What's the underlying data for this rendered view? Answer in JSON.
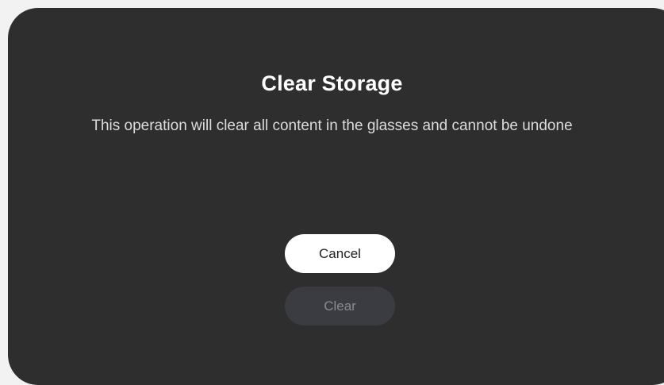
{
  "dialog": {
    "title": "Clear Storage",
    "message": "This operation will clear all content in the glasses and cannot be undone",
    "cancel_label": "Cancel",
    "clear_label": "Clear"
  },
  "colors": {
    "page_background": "#f2f2f2",
    "dialog_background": "#2e2e2f",
    "primary_button": "#ffffff",
    "disabled_button": "#3b3c42",
    "disabled_text": "#8a8b90"
  },
  "states": {
    "clear_button": "disabled"
  }
}
